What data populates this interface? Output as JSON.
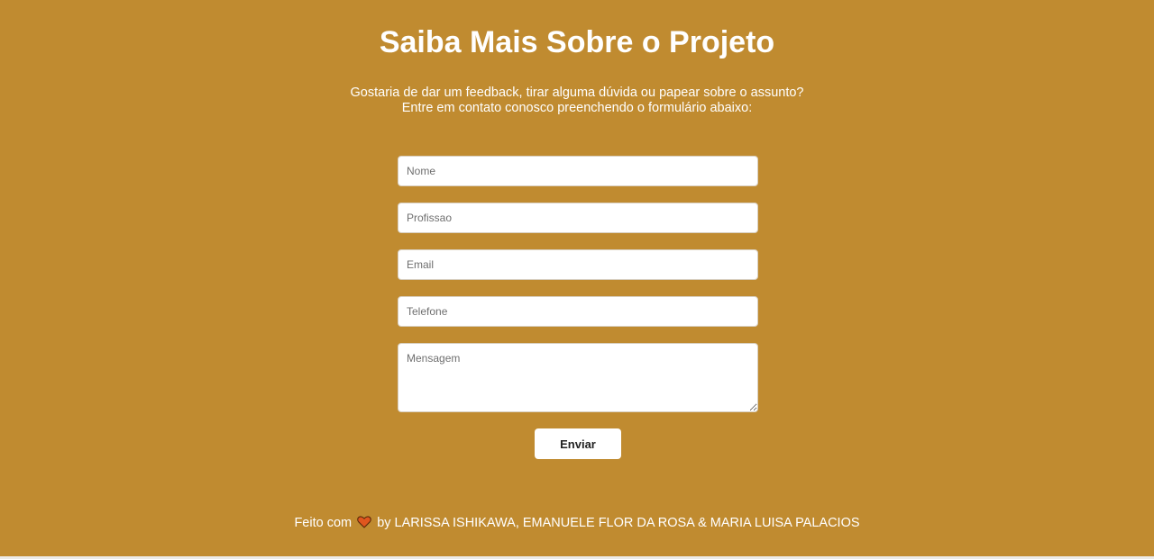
{
  "header": {
    "title": "Saiba Mais Sobre o Projeto",
    "subtitle_line1": "Gostaria de dar um feedback, tirar alguma dúvida ou papear sobre o assunto?",
    "subtitle_line2": "Entre em contato conosco preenchendo o formulário abaixo:"
  },
  "form": {
    "name_placeholder": "Nome",
    "profession_placeholder": "Profissao",
    "email_placeholder": "Email",
    "phone_placeholder": "Telefone",
    "message_placeholder": "Mensagem",
    "submit_label": "Enviar"
  },
  "footer": {
    "prefix": "Feito com",
    "icon": "heart-icon",
    "suffix": "by LARISSA ISHIKAWA, EMANUELE FLOR DA ROSA & MARIA LUISA PALACIOS"
  },
  "colors": {
    "background": "#c08b30",
    "heart": "#e0561e"
  }
}
